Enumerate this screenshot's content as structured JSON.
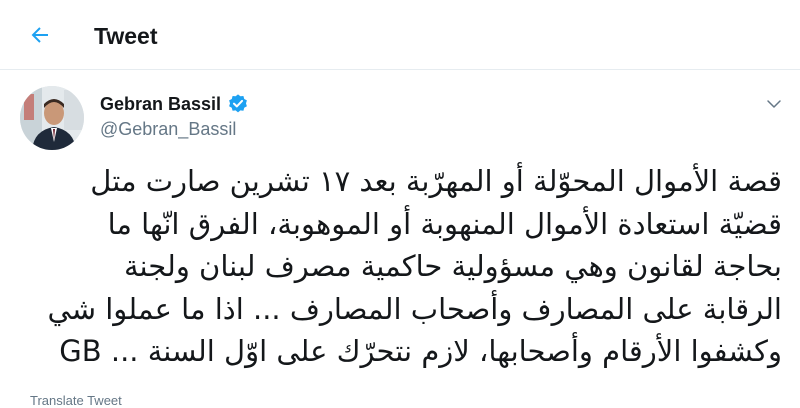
{
  "header": {
    "title": "Tweet",
    "back_icon": "arrow-left-icon",
    "accent_color": "#1da1f2"
  },
  "tweet": {
    "author_name": "Gebran Bassil",
    "handle": "@Gebran_Bassil",
    "verified": true,
    "verified_color": "#1da1f2",
    "more_icon": "chevron-down-icon",
    "lines": [
      "قصة الأموال المحوّلة أو المهرّبة بعد ١٧ تشرين صارت متل",
      "قضيّة استعادة الأموال المنهوبة أو الموهوبة، الفرق انّها ما",
      "بحاجة لقانون وهي مسؤولية حاكمية مصرف لبنان ولجنة",
      "الرقابة على المصارف وأصحاب المصارف ... اذا ما عملوا شي",
      "وكشفوا الأرقام وأصحابها، لازم نتحرّك على اوّل السنة ... GB"
    ],
    "footer_cut": "Translate Tweet"
  }
}
